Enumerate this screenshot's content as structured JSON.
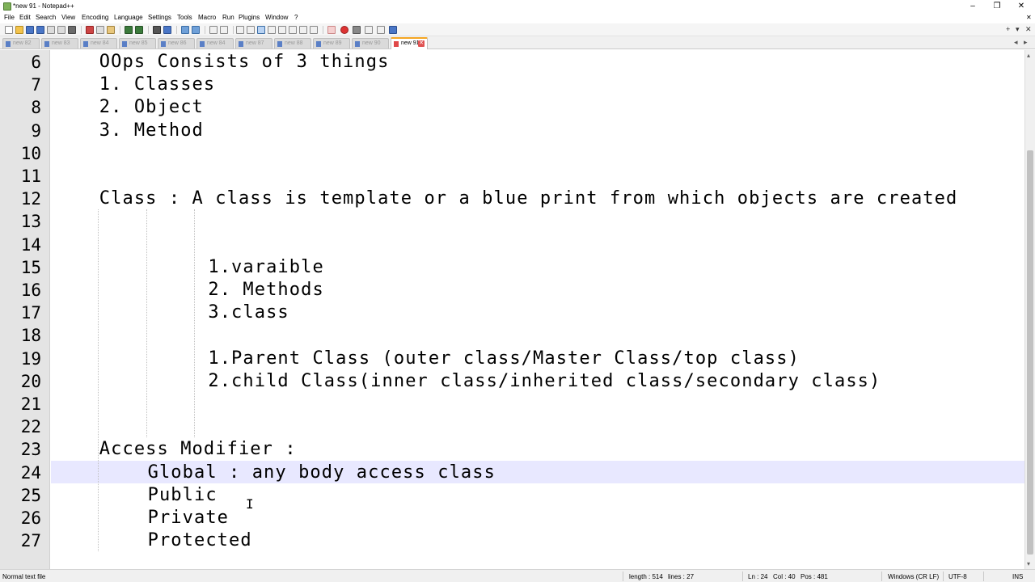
{
  "window": {
    "title": "*new 91 - Notepad++",
    "minimize": "–",
    "maximize": "❐",
    "close": "✕"
  },
  "menu": [
    "File",
    "Edit",
    "Search",
    "View",
    "Encoding",
    "Language",
    "Settings",
    "Tools",
    "Macro",
    "Run",
    "Plugins",
    "Window",
    "?"
  ],
  "menu_close": "✕",
  "toolbar_right": {
    "plus": "+",
    "dropdown": "▾",
    "close": "✕"
  },
  "tabs": [
    {
      "label": "new 82",
      "active": false
    },
    {
      "label": "new 83",
      "active": false
    },
    {
      "label": "new 84",
      "active": false
    },
    {
      "label": "new 85",
      "active": false
    },
    {
      "label": "new 86",
      "active": false
    },
    {
      "label": "new 84",
      "active": false
    },
    {
      "label": "new 87",
      "active": false
    },
    {
      "label": "new 88",
      "active": false
    },
    {
      "label": "new 89",
      "active": false
    },
    {
      "label": "new 90",
      "active": false
    },
    {
      "label": "new 91",
      "active": true
    }
  ],
  "tab_scroll": {
    "left": "◂",
    "right": "▸",
    "close": "✕"
  },
  "editor": {
    "current_line": 24,
    "lines": [
      {
        "num": "6",
        "text": "OOps Consists of 3 things",
        "indent": 4
      },
      {
        "num": "7",
        "text": "1. Classes",
        "indent": 4
      },
      {
        "num": "8",
        "text": "2. Object",
        "indent": 4
      },
      {
        "num": "9",
        "text": "3. Method",
        "indent": 4
      },
      {
        "num": "10",
        "text": "",
        "indent": 0
      },
      {
        "num": "11",
        "text": "",
        "indent": 0
      },
      {
        "num": "12",
        "text": "Class : A class is template or a blue print from which objects are created",
        "indent": 4
      },
      {
        "num": "13",
        "text": "",
        "indent": 0
      },
      {
        "num": "14",
        "text": "",
        "indent": 0
      },
      {
        "num": "15",
        "text": "1.varaible",
        "indent": 13
      },
      {
        "num": "16",
        "text": "2. Methods",
        "indent": 13
      },
      {
        "num": "17",
        "text": "3.class",
        "indent": 13
      },
      {
        "num": "18",
        "text": "",
        "indent": 0
      },
      {
        "num": "19",
        "text": "1.Parent Class (outer class/Master Class/top class)",
        "indent": 13
      },
      {
        "num": "20",
        "text": "2.child Class(inner class/inherited class/secondary class)",
        "indent": 13
      },
      {
        "num": "21",
        "text": "",
        "indent": 0
      },
      {
        "num": "22",
        "text": "",
        "indent": 0
      },
      {
        "num": "23",
        "text": "Access Modifier :",
        "indent": 4
      },
      {
        "num": "24",
        "text": "Global : any body access class",
        "indent": 8
      },
      {
        "num": "25",
        "text": "Public",
        "indent": 8
      },
      {
        "num": "26",
        "text": "Private",
        "indent": 8
      },
      {
        "num": "27",
        "text": "Protected",
        "indent": 8
      }
    ]
  },
  "scrollbar": {
    "up": "▴",
    "down": "▾"
  },
  "cursor_glyph": "I",
  "status": {
    "file_type": "Normal text file",
    "length": "length : 514",
    "lines": "lines : 27",
    "ln": "Ln : 24",
    "col": "Col : 40",
    "pos": "Pos : 481",
    "eol": "Windows (CR LF)",
    "encoding": "UTF-8",
    "mode": "INS"
  },
  "colors": {
    "current_line": "#e8e8ff",
    "gutter": "#e4e4e4",
    "active_tab_accent": "#f5a623"
  }
}
